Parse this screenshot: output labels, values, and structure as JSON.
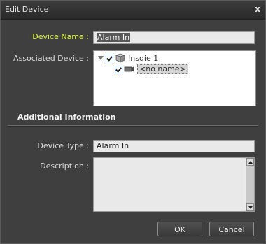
{
  "window": {
    "title": "Edit Device",
    "close_glyph": "x"
  },
  "form": {
    "device_name_label": "Device Name :",
    "device_name_value": "Alarm In",
    "associated_device_label": "Associated Device :",
    "tree": [
      {
        "label": "Insdie 1",
        "icon": "server-icon",
        "checked": true,
        "expanded": true
      },
      {
        "label": "<no name>",
        "icon": "camera-icon",
        "checked": true,
        "selected": true
      }
    ]
  },
  "additional": {
    "header": "Additional Information",
    "device_type_label": "Device Type :",
    "device_type_value": "Alarm In",
    "description_label": "Description :",
    "description_value": ""
  },
  "buttons": {
    "ok_label": "OK",
    "cancel_label": "Cancel"
  },
  "colors": {
    "highlight_label": "#d5ef3a",
    "dialog_bg": "#3f3f3f"
  }
}
